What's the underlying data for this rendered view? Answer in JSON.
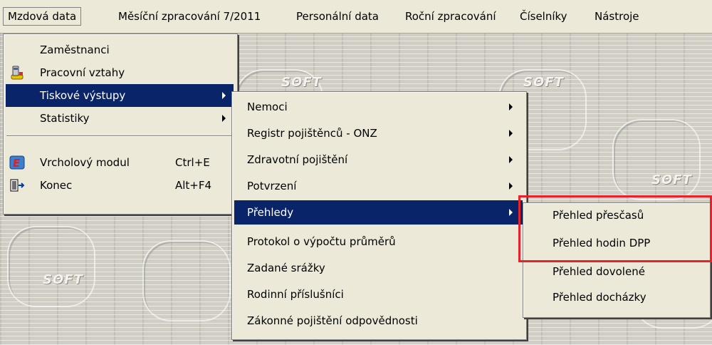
{
  "menubar": {
    "items": [
      {
        "label": "Mzdová data"
      },
      {
        "label": "Měsíční zpracování 7/2011"
      },
      {
        "label": "Personální data"
      },
      {
        "label": "Roční zpracování"
      },
      {
        "label": "Číselníky"
      },
      {
        "label": "Nástroje"
      }
    ]
  },
  "menu_mzdova": {
    "items": [
      {
        "label": "Zaměstnanci"
      },
      {
        "label": "Pracovní vztahy",
        "icon": "phone-icon"
      },
      {
        "label": "Tiskové výstupy"
      },
      {
        "label": "Statistiky"
      },
      {
        "label": "Vrcholový modul",
        "shortcut": "Ctrl+E",
        "icon": "e-module-icon"
      },
      {
        "label": "Konec",
        "shortcut": "Alt+F4",
        "icon": "exit-door-icon"
      }
    ]
  },
  "menu_tiskove": {
    "items": [
      {
        "label": "Nemoci"
      },
      {
        "label": "Registr pojištěnců - ONZ"
      },
      {
        "label": "Zdravotní pojištění"
      },
      {
        "label": "Potvrzení"
      },
      {
        "label": "Přehledy"
      },
      {
        "label": "Protokol o výpočtu průměrů"
      },
      {
        "label": "Zadané srážky"
      },
      {
        "label": "Rodinní příslušníci"
      },
      {
        "label": "Zákonné pojištění odpovědnosti"
      }
    ]
  },
  "menu_prehledy": {
    "items": [
      {
        "label": "Přehled přesčasů"
      },
      {
        "label": "Přehled hodin DPP"
      },
      {
        "label": "Přehled dovolené"
      },
      {
        "label": "Přehled docházky"
      }
    ]
  },
  "colors": {
    "menu_bg": "#ece9d8",
    "selection": "#0a246a",
    "highlight_box": "#e8222c"
  }
}
